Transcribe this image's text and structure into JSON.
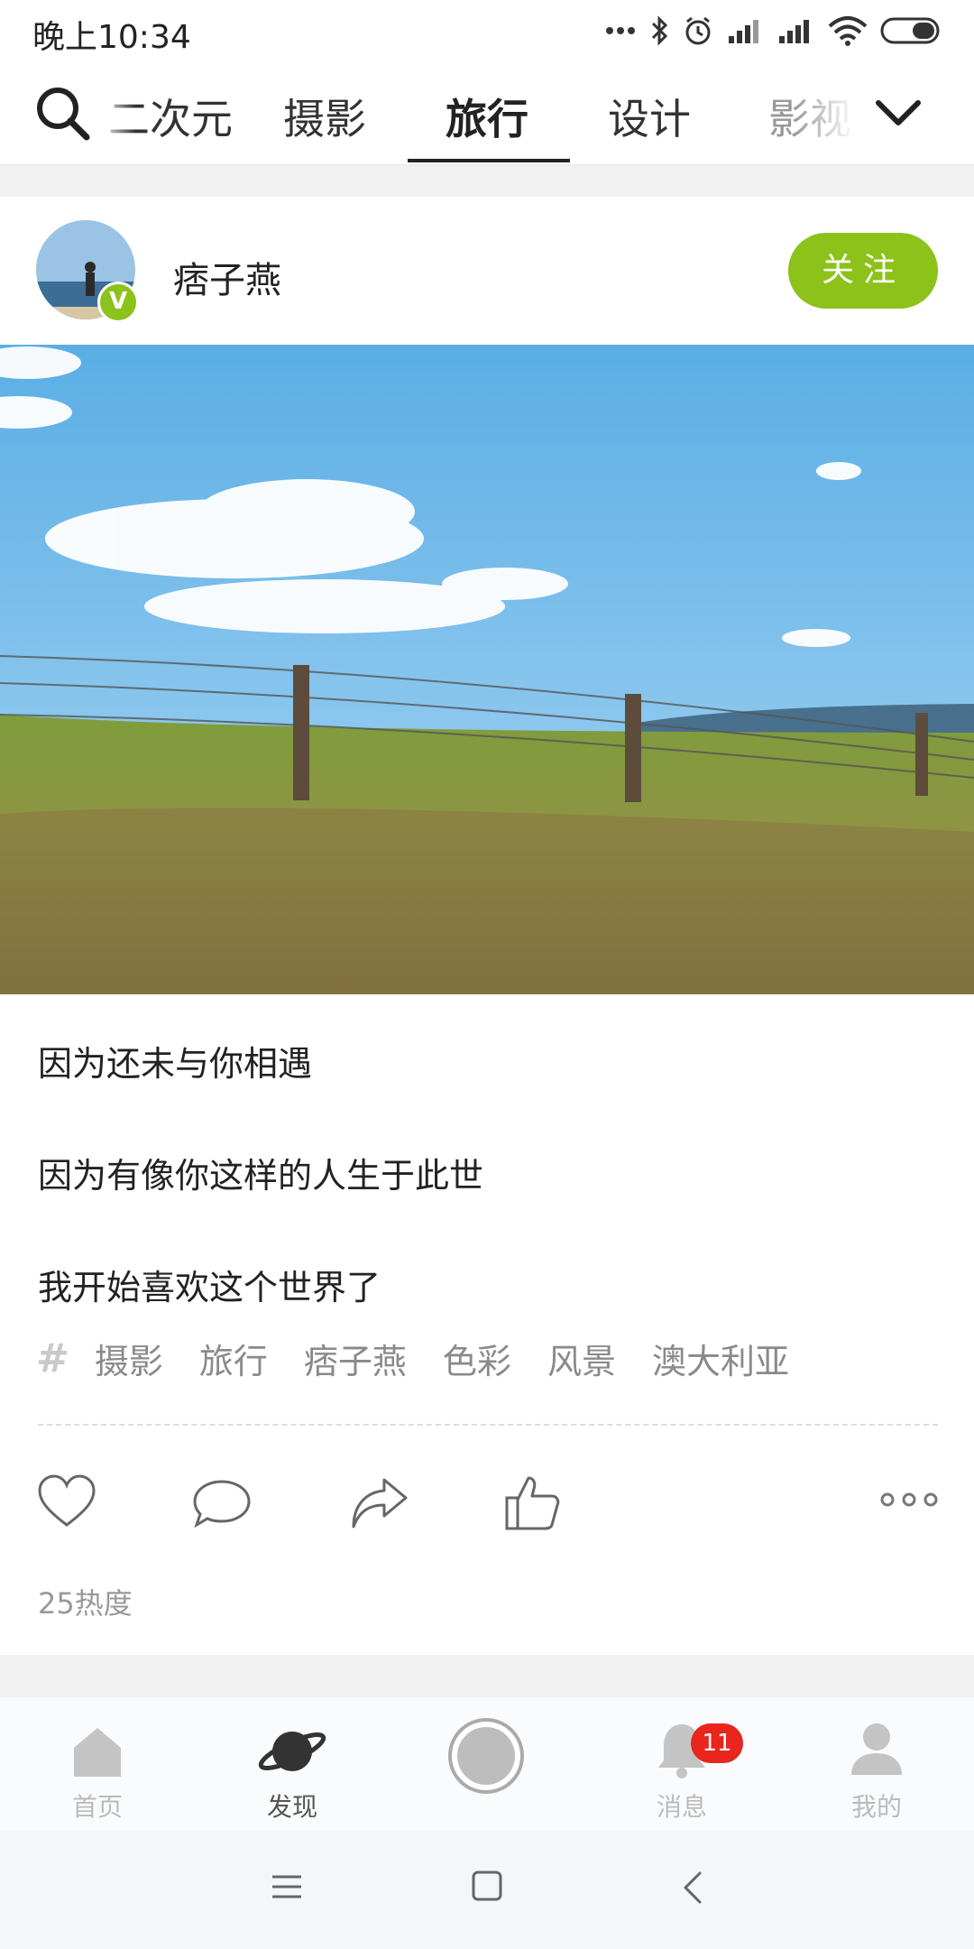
{
  "status_bar": {
    "time": "晚上10:34"
  },
  "tabs": [
    {
      "label": "二次元",
      "active": false
    },
    {
      "label": "摄影",
      "active": false
    },
    {
      "label": "旅行",
      "active": true
    },
    {
      "label": "设计",
      "active": false
    },
    {
      "label": "影视",
      "active": false
    }
  ],
  "post": {
    "author": "痞子燕",
    "follow_label": "关注",
    "lines": [
      "因为还未与你相遇",
      "因为有像你这样的人生于此世",
      "我开始喜欢这个世界了"
    ],
    "tags": [
      "摄影",
      "旅行",
      "痞子燕",
      "色彩",
      "风景",
      "澳大利亚"
    ],
    "heat": "25热度"
  },
  "bottom_nav": {
    "items": [
      {
        "label": "首页",
        "icon": "home-icon"
      },
      {
        "label": "发现",
        "icon": "planet-icon"
      },
      {
        "label": "",
        "icon": "camera-center-icon"
      },
      {
        "label": "消息",
        "icon": "bell-icon"
      },
      {
        "label": "我的",
        "icon": "person-icon"
      }
    ],
    "message_badge": "11"
  },
  "colors": {
    "accent": "#8cc21a",
    "badge": "#e8261d"
  }
}
